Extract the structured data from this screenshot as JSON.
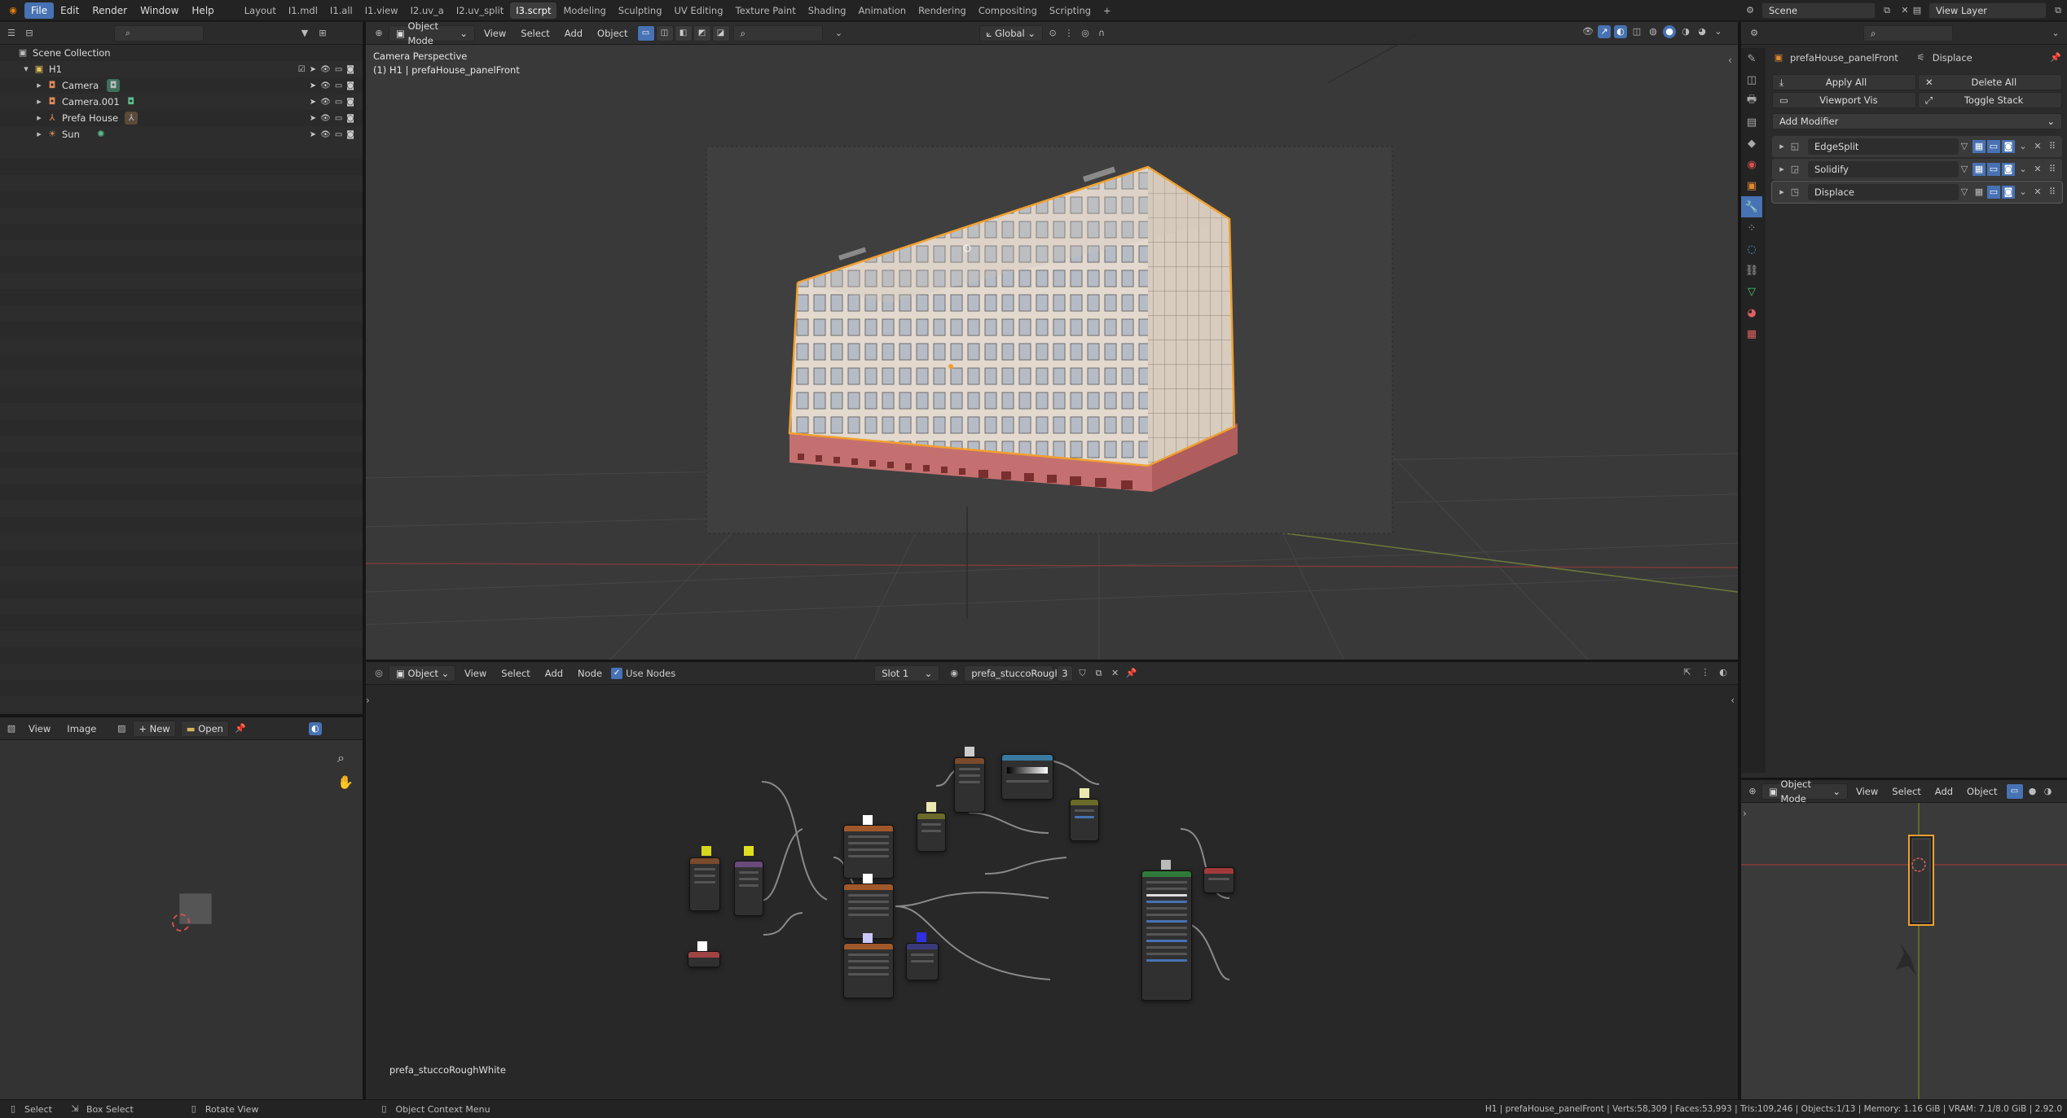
{
  "topbar": {
    "menus": [
      "File",
      "Edit",
      "Render",
      "Window",
      "Help"
    ],
    "workspaces": [
      "Layout",
      "I1.mdl",
      "I1.all",
      "I1.view",
      "I2.uv_a",
      "I2.uv_split",
      "I3.scrpt",
      "Modeling",
      "Sculpting",
      "UV Editing",
      "Texture Paint",
      "Shading",
      "Animation",
      "Rendering",
      "Compositing",
      "Scripting"
    ],
    "active_workspace": "I3.scrpt",
    "add_tab": "+",
    "scene_label": "Scene",
    "view_layer_label": "View Layer"
  },
  "outliner": {
    "root": "Scene Collection",
    "collection": "H1",
    "items": [
      {
        "name": "Camera",
        "icon": "camera-icon"
      },
      {
        "name": "Camera.001",
        "icon": "camera-icon"
      },
      {
        "name": "Prefa House",
        "icon": "armature-icon"
      },
      {
        "name": "Sun",
        "icon": "light-icon"
      }
    ]
  },
  "viewport": {
    "mode": "Object Mode",
    "menus": [
      "View",
      "Select",
      "Add",
      "Object"
    ],
    "transform": "Global",
    "overlay_title": "Camera Perspective",
    "overlay_sub": "(1) H1 | prefaHouse_panelFront"
  },
  "node_editor": {
    "type": "Object",
    "menus": [
      "View",
      "Select",
      "Add",
      "Node"
    ],
    "use_nodes": "Use Nodes",
    "slot": "Slot 1",
    "material": "prefa_stuccoRough...",
    "users": "3",
    "material_label": "prefa_stuccoRoughWhite"
  },
  "image_editor": {
    "menus": [
      "View",
      "Image"
    ],
    "new_label": "New",
    "open_label": "Open"
  },
  "properties": {
    "object": "prefaHouse_panelFront",
    "modifier_context": "Displace",
    "apply_all": "Apply All",
    "delete_all": "Delete All",
    "viewport_vis": "Viewport Vis",
    "toggle_stack": "Toggle Stack",
    "add_modifier": "Add Modifier",
    "modifiers": [
      "EdgeSplit",
      "Solidify",
      "Displace"
    ]
  },
  "mini_viewport": {
    "mode": "Object Mode",
    "menus": [
      "View",
      "Select",
      "Add",
      "Object"
    ]
  },
  "statusbar": {
    "left": [
      {
        "icon": "mouse-left-icon",
        "label": "Select"
      },
      {
        "icon": "mouse-drag-icon",
        "label": "Box Select"
      },
      {
        "icon": "mouse-middle-icon",
        "label": "Rotate View"
      },
      {
        "icon": "mouse-right-icon",
        "label": "Object Context Menu"
      }
    ],
    "stats": "H1 | prefaHouse_panelFront | Verts:58,309 | Faces:53,993 | Tris:109,246 | Objects:1/13 | Memory: 1.16 GiB | VRAM: 7.1/8.0 GiB | 2.92.0"
  },
  "colors": {
    "accent": "#4772b3",
    "selection_outline": "#f0a030",
    "building_base": "#c87070",
    "building_wall": "#e2d8cd"
  }
}
